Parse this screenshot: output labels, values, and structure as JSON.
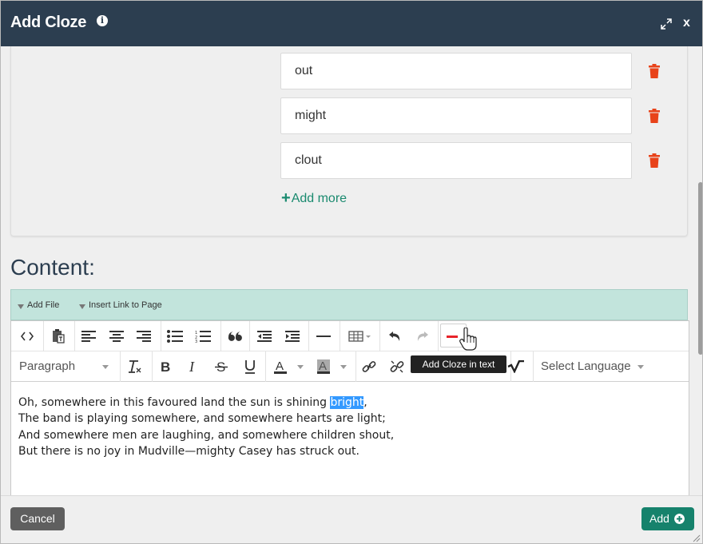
{
  "dialog": {
    "title": "Add Cloze",
    "info_icon": "info-icon",
    "expand_icon": "expand-icon",
    "close_label": "x"
  },
  "options": {
    "items": [
      {
        "value": "out"
      },
      {
        "value": "might"
      },
      {
        "value": "clout"
      }
    ],
    "delete_icon": "trash-icon",
    "delete_color": "#e8431a",
    "add_more_icon": "+",
    "add_more_label": "Add more"
  },
  "content": {
    "label": "Content:"
  },
  "helper_toolbar": {
    "add_file_label": "Add File",
    "insert_link_label": "Insert Link to Page"
  },
  "editor_toolbar": {
    "row1": [
      "source-code-icon",
      "paste-text-icon",
      "align-left-icon",
      "align-center-icon",
      "align-right-icon",
      "bulleted-list-icon",
      "numbered-list-icon",
      "blockquote-icon",
      "outdent-icon",
      "indent-icon",
      "horizontal-rule-icon",
      "table-icon",
      "undo-icon",
      "redo-icon",
      "add-cloze-icon"
    ],
    "format_value": "Paragraph",
    "row2": [
      "clear-format-icon",
      "bold-icon",
      "italic-icon",
      "strikethrough-icon",
      "underline-icon",
      "text-color-icon",
      "background-color-icon",
      "link-icon",
      "unlink-icon",
      "math-icon"
    ],
    "language_value": "Select Language",
    "tooltip": "Add Cloze in text",
    "cloze_color": "#e8232a"
  },
  "editor_text": {
    "line1_before": "Oh, somewhere in this favoured land the sun is shining ",
    "line1_highlight": "bright",
    "line1_after": ",",
    "line2": "The band is playing somewhere, and somewhere hearts are light;",
    "line3": "And somewhere men are laughing, and somewhere children shout,",
    "line4": "But there is no joy in Mudville—mighty Casey has struck out."
  },
  "footer": {
    "cancel_label": "Cancel",
    "add_label": "Add",
    "add_icon": "plus-circle-icon",
    "accent": "#16826c"
  }
}
